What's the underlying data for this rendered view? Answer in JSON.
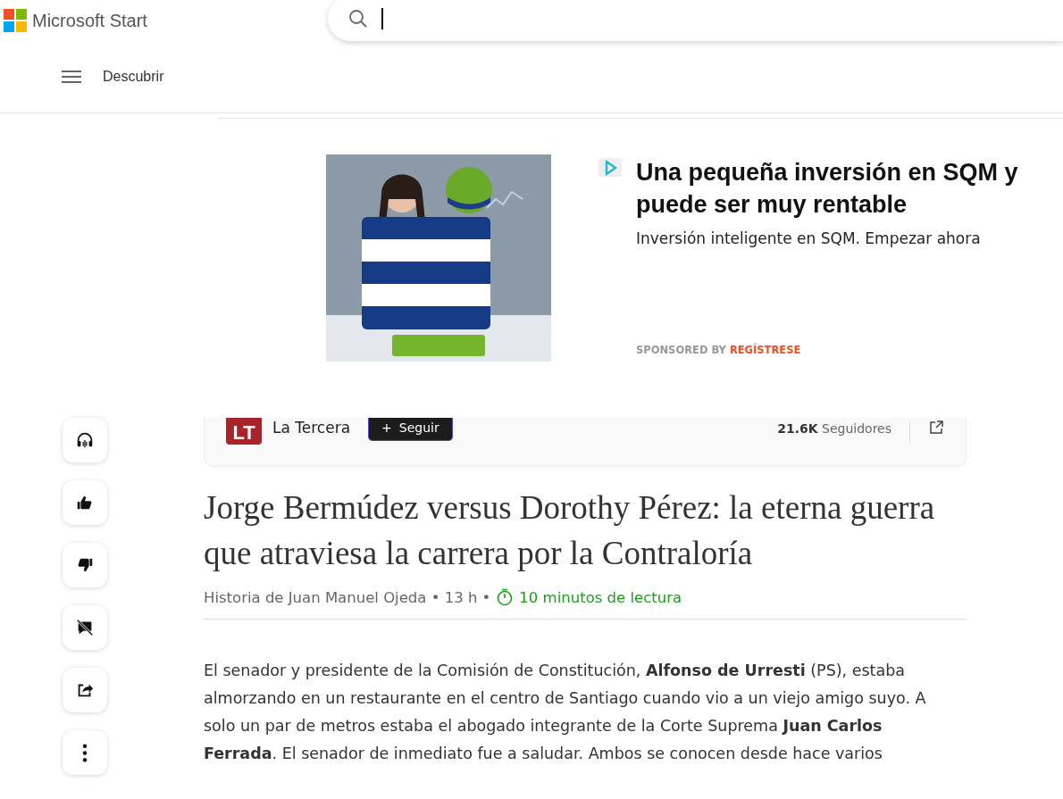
{
  "header": {
    "logo": "Microsoft Start",
    "search_field": {
      "focused": true
    }
  },
  "nav": {
    "label": "Descubrir"
  },
  "ad": {
    "title": "Una pequeña inversión en SQM y puede ser muy rentable",
    "description": "Inversión inteligente en SQM. Empezar ahora",
    "sponsored_label": "SPONSORED BY",
    "sponsor": "REGÍSTRESE"
  },
  "actions": [
    {
      "kind": "listen"
    },
    {
      "kind": "like"
    },
    {
      "kind": "dislike"
    },
    {
      "kind": "comments_off"
    },
    {
      "kind": "share"
    },
    {
      "kind": "more"
    }
  ],
  "publisher": {
    "logo_text": "LT",
    "name": "La Tercera",
    "follow_icon": "+",
    "follow_label": "Seguir",
    "followers_count": "21.6K",
    "followers_label": "Seguidores"
  },
  "article": {
    "title": "Jorge Bermúdez versus Dorothy Pérez: la eterna guerra que atraviesa la carrera por la Contraloría",
    "byline": "Historia de Juan Manuel Ojeda • 13 h •",
    "read_time": "10 minutos de lectura",
    "paragraph": "El senador y presidente de la Comisión de Constitución, **Alfonso de Urresti** (PS), estaba almorzando en un restaurante en el centro de Santiago cuando vio a un viejo amigo suyo. A solo un par de metros estaba el abogado integrante de la Corte Suprema **Juan Carlos Ferrada**. El senador de inmediato fue a saludar. Ambos se conocen desde hace varios"
  }
}
